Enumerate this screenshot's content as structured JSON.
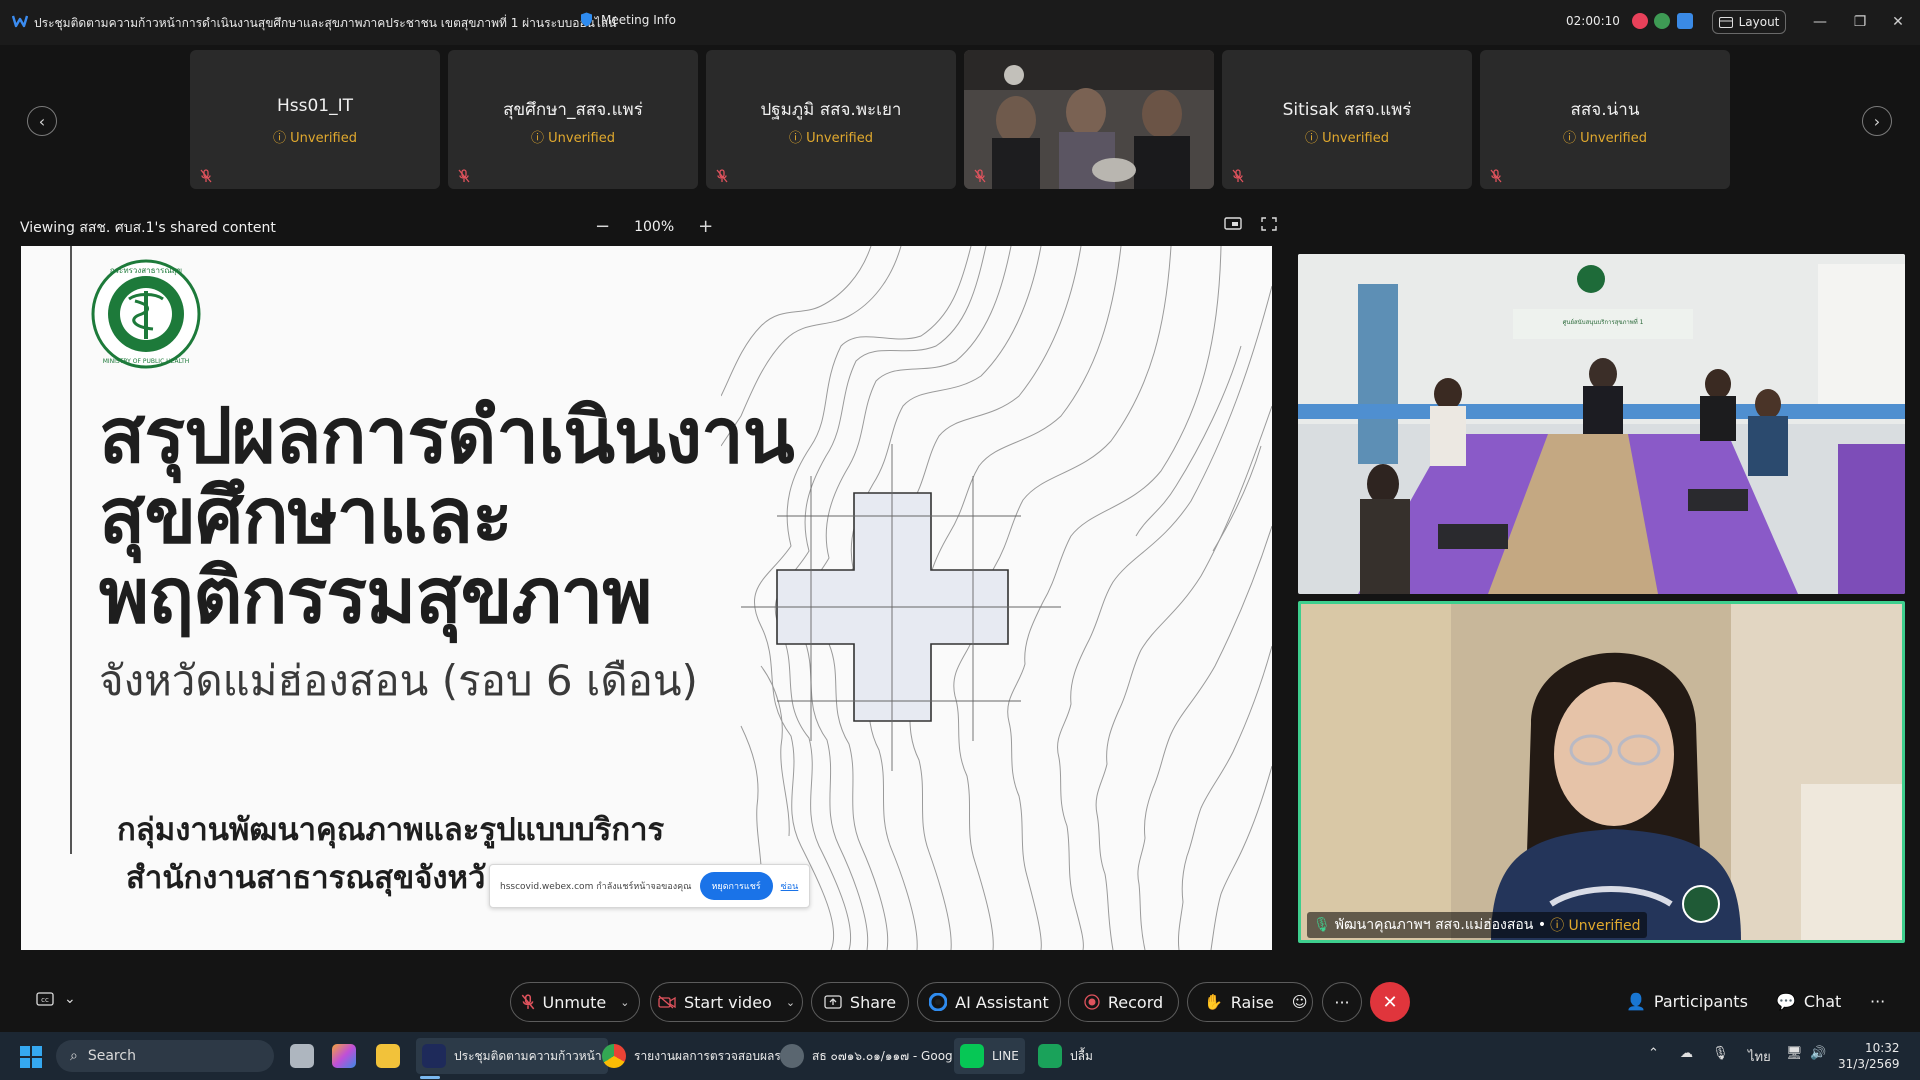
{
  "window": {
    "title": "ประชุมติดตามความก้าวหน้าการดำเนินงานสุขศึกษาและสุขภาพภาคประชาชน เขตสุขภาพที่ 1 ผ่านระบบออนไลน์",
    "meeting_info": "Meeting Info",
    "timer": "02:00:10",
    "layout_label": "Layout"
  },
  "participants_strip": [
    {
      "name": "Hss01_IT",
      "status": "Unverified"
    },
    {
      "name": "สุขศึกษา_สสจ.แพร่",
      "status": "Unverified"
    },
    {
      "name": "ปฐมภูมิ สสจ.พะเยา",
      "status": "Unverified"
    },
    {
      "name": "",
      "status": ""
    },
    {
      "name": "Sitisak สสจ.แพร่",
      "status": "Unverified"
    },
    {
      "name": "สสจ.น่าน",
      "status": "Unverified"
    }
  ],
  "share": {
    "viewing_text": "Viewing สสช. ศบส.1's shared content",
    "zoom_minus": "−",
    "zoom_level": "100%",
    "zoom_plus": "+"
  },
  "slide": {
    "title_line1": "สรุปผลการดำเนินงาน",
    "title_line2": "สุขศึกษาและ",
    "title_line3": "พฤติกรรมสุขภาพ",
    "subtitle": "จังหวัดแม่ฮ่องสอน (รอบ 6 เดือน)",
    "dept_line1": "กลุ่มงานพัฒนาคุณภาพและรูปแบบบริการ",
    "dept_line2": "สำนักงานสาธารณสุขจังหวั",
    "logo_text_top": "กระทรวงสาธารณสุข",
    "logo_text_bottom": "MINISTRY OF PUBLIC HEALTH",
    "notification": {
      "text": "hsscovid.webex.com กำลังแชร์หน้าจอของคุณ",
      "button": "หยุดการแชร์",
      "link": "ซ่อน"
    }
  },
  "videos": [
    {
      "room_sign": "ศูนย์สนับสนุนบริการสุขภาพที่ 1"
    },
    {
      "label": "พัฒนาคุณภาพฯ สสจ.แม่ฮ่องสอน •",
      "status": "Unverified"
    }
  ],
  "controls": {
    "unmute": "Unmute",
    "start_video": "Start video",
    "share": "Share",
    "ai_assistant": "AI Assistant",
    "record": "Record",
    "raise": "Raise",
    "more": "···",
    "participants": "Participants",
    "chat": "Chat",
    "overflow": "···"
  },
  "taskbar": {
    "search": "Search",
    "apps": [
      {
        "label": "ประชุมติดตามความก้าวหน้า"
      },
      {
        "label": "รายงานผลการตรวจสอบผลร"
      },
      {
        "label": "สธ ๐๗๑๖.๐๑/๑๑๗ - Goog"
      },
      {
        "label": "LINE"
      },
      {
        "label": "ปลื้ม"
      }
    ],
    "language": "ไทย",
    "time": "10:32",
    "date": "31/3/2569"
  },
  "colors": {
    "accent_green": "#3ecf8e",
    "unverified": "#e1a92e",
    "end_call": "#e0353c",
    "webex_blue": "#1a73e8"
  }
}
